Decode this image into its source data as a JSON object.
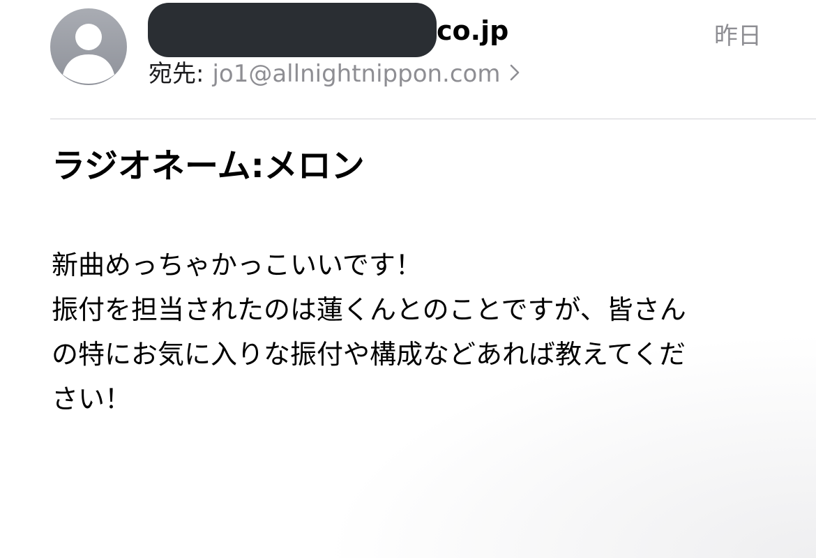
{
  "sender": {
    "visible_suffix": "co.jp"
  },
  "date": "昨日",
  "recipient": {
    "label": "宛先:",
    "address": "jo1@allnightnippon.com"
  },
  "subject": "ラジオネーム:メロン",
  "body_lines": [
    "新曲めっちゃかっこいいです！",
    "振付を担当されたのは蓮くんとのことですが、皆さん",
    "の特にお気に入りな振付や構成などあれば教えてくだ",
    "さい！"
  ],
  "colors": {
    "avatar": "#989ba2",
    "secondary_text": "#8e8e93",
    "divider": "#d1d1d6",
    "redaction": "#2a2e33"
  },
  "icons": {
    "avatar": "person-placeholder-icon",
    "disclosure": "chevron-right-icon"
  }
}
